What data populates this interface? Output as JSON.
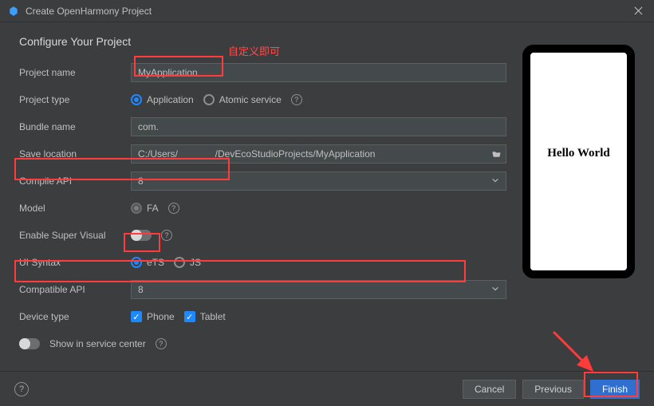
{
  "window": {
    "title": "Create OpenHarmony Project"
  },
  "heading": "Configure Your Project",
  "annot": {
    "custom": "自定义即可"
  },
  "form": {
    "projectName": {
      "label": "Project name",
      "value": "MyApplication"
    },
    "projectType": {
      "label": "Project type",
      "options": {
        "application": "Application",
        "atomic": "Atomic service"
      },
      "selected": "application"
    },
    "bundleName": {
      "label": "Bundle name",
      "value": "com."
    },
    "saveLocation": {
      "label": "Save location",
      "value": "C:/Users/              /DevEcoStudioProjects/MyApplication"
    },
    "compileApi": {
      "label": "Compile API",
      "value": "8"
    },
    "model": {
      "label": "Model",
      "value": "FA"
    },
    "enableSuperVisual": {
      "label": "Enable Super Visual"
    },
    "uiSyntax": {
      "label": "UI Syntax",
      "options": {
        "ets": "eTS",
        "js": "JS"
      },
      "selected": "ets"
    },
    "compatibleApi": {
      "label": "Compatible API",
      "value": "8"
    },
    "deviceType": {
      "label": "Device type",
      "options": {
        "phone": "Phone",
        "tablet": "Tablet"
      }
    },
    "showInServiceCenter": {
      "label": "Show in service center"
    }
  },
  "preview": {
    "text": "Hello World"
  },
  "footer": {
    "cancel": "Cancel",
    "previous": "Previous",
    "finish": "Finish"
  }
}
